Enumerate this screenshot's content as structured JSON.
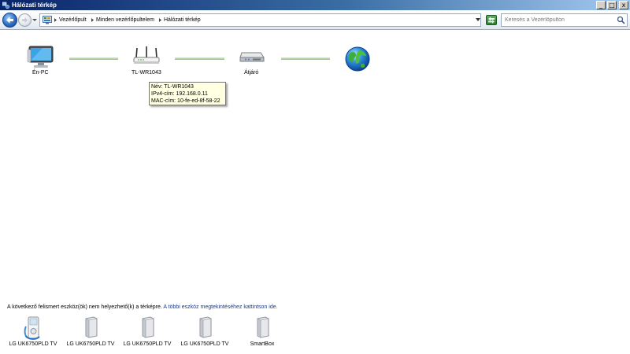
{
  "window": {
    "title": "Hálózati térkép",
    "controls": {
      "minimize": "_",
      "maximize": "□",
      "close": "x"
    }
  },
  "addressbar": {
    "breadcrumb": [
      "Vezérlőpult",
      "Minden vezérlőpultelem",
      "Hálózati térkép"
    ],
    "search_placeholder": "Keresés a Vezérlőpulton"
  },
  "map": {
    "nodes": [
      {
        "label": "Én-PC",
        "icon": "computer-icon"
      },
      {
        "label": "TL-WR1043",
        "icon": "router-icon"
      },
      {
        "label": "Átjáró",
        "icon": "gateway-icon"
      },
      {
        "label": "",
        "icon": "internet-globe-icon"
      }
    ],
    "tooltip": {
      "name": "Név: TL-WR1043",
      "ipv4": "IPv4-cím: 192.168.0.11",
      "mac": "MAC-cím: 10-fe-ed-8f-58-22"
    }
  },
  "unplaced": {
    "message": "A következő felismert eszköz(ök) nem helyezhető(k) a térképre. ",
    "link": "A többi eszköz megtekintéséhez kattintson ide.",
    "devices": [
      {
        "label": "LG UK6750PLD TV",
        "icon": "media-device-icon"
      },
      {
        "label": "LG UK6750PLD TV",
        "icon": "device-tower-icon"
      },
      {
        "label": "LG UK6750PLD TV",
        "icon": "device-tower-icon"
      },
      {
        "label": "LG UK6750PLD TV",
        "icon": "device-tower-icon"
      },
      {
        "label": "SmartBox",
        "icon": "device-tower-icon"
      }
    ]
  },
  "colors": {
    "link_line": "#b7d7a4",
    "tooltip_bg": "#ffffe1",
    "hyperlink": "#1e3b8c"
  }
}
